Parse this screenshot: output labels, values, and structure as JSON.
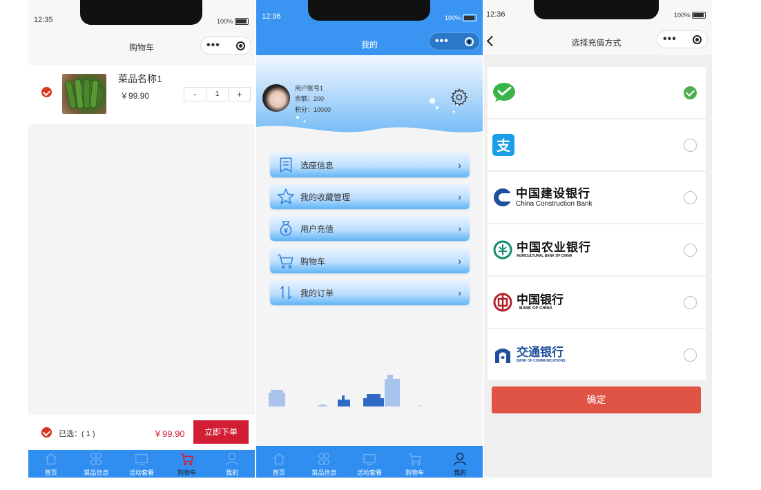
{
  "cart_screen": {
    "status_time": "12:35",
    "battery": "100%",
    "title": "购物车",
    "item": {
      "name": "菜品名称1",
      "price": "￥99.90",
      "qty": "1",
      "minus": "-",
      "plus": "+"
    },
    "footer": {
      "selected": "已选：( 1 )",
      "total": "￥99.90",
      "order_btn": "立即下单"
    },
    "tabs": [
      {
        "label": "首页"
      },
      {
        "label": "菜品信息"
      },
      {
        "label": "活动套餐"
      },
      {
        "label": "购物车"
      },
      {
        "label": "我的"
      }
    ],
    "colors": {
      "tabbar": "#2f8ef0",
      "accent": "#d21e35",
      "active_tab": "#d21e35"
    }
  },
  "profile_screen": {
    "status_time": "12:36",
    "battery": "100%",
    "title": "我的",
    "user": {
      "account": "用户账号1",
      "balance": "余额：200",
      "points": "积分：10000"
    },
    "menu": [
      {
        "label": "选座信息",
        "icon": "seat-doc-icon"
      },
      {
        "label": "我的收藏管理",
        "icon": "star-icon"
      },
      {
        "label": "用户充值",
        "icon": "money-bag-icon"
      },
      {
        "label": "购物车",
        "icon": "cart-icon"
      },
      {
        "label": "我的订单",
        "icon": "sort-arrows-icon"
      }
    ],
    "tabs": [
      {
        "label": "首页"
      },
      {
        "label": "菜品信息"
      },
      {
        "label": "活动套餐"
      },
      {
        "label": "购物车"
      },
      {
        "label": "我的"
      }
    ],
    "colors": {
      "header": "#3a94f2",
      "tabbar": "#2f8ef0"
    }
  },
  "payment_screen": {
    "status_time": "12:36",
    "battery": "100%",
    "title": "选择充值方式",
    "methods": [
      {
        "name": "wechat-pay",
        "selected": true
      },
      {
        "name": "alipay",
        "selected": false
      },
      {
        "name": "ccb",
        "logo_cn": "中国建设银行",
        "logo_en": "China Construction Bank",
        "selected": false
      },
      {
        "name": "abc",
        "logo_cn": "中国农业银行",
        "logo_en": "AGRICULTURAL BANK OF CHINA",
        "selected": false
      },
      {
        "name": "boc",
        "logo_cn": "中国银行",
        "logo_en": "BANK OF CHINA",
        "selected": false
      },
      {
        "name": "bocom",
        "logo_cn": "交通银行",
        "logo_en": "BANK OF COMMUNICATIONS",
        "selected": false
      }
    ],
    "confirm_btn": "确定",
    "colors": {
      "confirm": "#e05445",
      "selected": "#4cae4c"
    }
  }
}
